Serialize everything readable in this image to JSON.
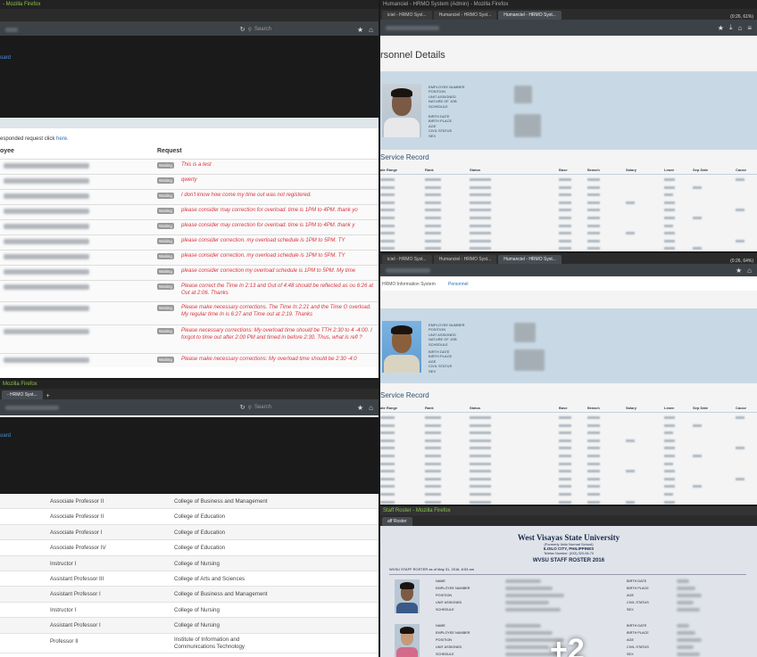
{
  "tile1": {
    "window_title": "- Mozilla Firefox",
    "search_placeholder": "Search",
    "sidebar_link": "oard",
    "note_prefix": "esponded request click",
    "note_link": "here.",
    "col_employee": "oyee",
    "col_request": "Request",
    "badge": "Waiting",
    "requests": [
      "This is a test",
      "qwerty",
      "I don't know how come my time out was not registered.",
      "please consider may correction for overload. time is 1PM to 4PM. thank yo",
      "please consider may correction for overload. time is 1PM to 4PM. thank y",
      "please consider correction. my overload schedule is 1PM to 5PM. TY",
      "please consider correction. my overload schedule is 1PM to 5PM. TY",
      "please consider correction my overload schedule is 1PM to 5PM. My time",
      "Please correct the Time In 2:13 and Out of 4:48 should be reflected as ou 6:26 at Out at 2:06. Thanks",
      "Please make necessary corrections. The Time In 2:21 and the Time O overload. My regular time In is 6:27 and Time out at 2:19. Thanks",
      "Please necessary corrections: My overload time should be TTH 2:30 to 4 -4:00. I forgot to time out after 2:00 PM and timed in before 2:30. Thus, what is refl ?",
      "Please make necessary corrections: My overload time should be 2:30 -4:0"
    ]
  },
  "tile2": {
    "window_title": "Humanciel - HRMO System (Admin) - Mozilla Firefox",
    "tabs": [
      "iciel - HRMO Syst...",
      "Humanciel - HRMO Syst...",
      "Humanciel - HRMO Syst..."
    ],
    "battery": "(0:26, 61%)",
    "page_heading": "rsonnel Details",
    "section_heading": "Service Record",
    "labels_a": [
      "EMPLOYEE NUMBER",
      "POSITION",
      "UNIT ASSIGNED",
      "NATURE OF JOB",
      "SCHEDULE"
    ],
    "labels_b": [
      "BIRTH DATE",
      "BIRTH PLACE",
      "AGE",
      "CIVIL STATUS",
      "SEX"
    ],
    "columns": [
      "ate Range",
      "Rank",
      "Status",
      "Base",
      "Branch",
      "Salary",
      "Leave",
      "Sep Date",
      "Cause"
    ]
  },
  "tile3": {
    "tabs": [
      "iciel - HRMO Syst...",
      "Humanciel - HRMO Syst...",
      "Humanciel - HRMO Syst..."
    ],
    "battery": "(0:26, 64%)",
    "nav_title": "HRMO Information System",
    "nav_user": "Personnel",
    "section_heading": "Service Record",
    "labels_a": [
      "EMPLOYEE NUMBER",
      "POSITION",
      "UNIT ASSIGNED",
      "NATURE OF JOB",
      "SCHEDULE"
    ],
    "labels_b": [
      "BIRTH DATE",
      "BIRTH PLACE",
      "AGE",
      "CIVIL STATUS",
      "SEX"
    ],
    "columns": [
      "ate Range",
      "Rank",
      "Status",
      "Base",
      "Branch",
      "Salary",
      "Leave",
      "Sep Date",
      "Cause"
    ]
  },
  "tile4": {
    "window_title": "Mozilla Firefox",
    "tab": "- HRMO Syst...",
    "search_placeholder": "Search",
    "sidebar_link": "oard",
    "rows": [
      {
        "position": "Associate Professor II",
        "college": "College of Business and Management"
      },
      {
        "position": "Associate Professor II",
        "college": "College of Education"
      },
      {
        "position": "Associate Professor I",
        "college": "College of Education"
      },
      {
        "position": "Associate Professor IV",
        "college": "College of Education"
      },
      {
        "position": "Instructor I",
        "college": "College of Nursing"
      },
      {
        "position": "Assistant Professor III",
        "college": "College of Arts and Sciences"
      },
      {
        "position": "Assistant Professor I",
        "college": "College of Business and Management"
      },
      {
        "position": "Instructor I",
        "college": "College of Nursing"
      },
      {
        "position": "Assistant Professor I",
        "college": "College of Nursing"
      },
      {
        "position": "Professor II",
        "college": "Institute of Information and Communications Technology"
      }
    ]
  },
  "tile5": {
    "window_title": "Staff Roster - Mozilla Firefox",
    "tab": "aff Roster",
    "university": "West Visayas State University",
    "sub1": "(Formerly Iloilo Normal School)",
    "sub2": "ILOILO CITY, PHILIPPINES",
    "sub3": "Telefax Number: (033) 320-08-70",
    "roster_title": "WVSU STAFF ROSTER 2016",
    "roster_asof": "WVSU STAFF ROSTER as of May 31, 2016, 8:53 am",
    "labels_left": [
      "NAME",
      "EMPLOYEE NUMBER",
      "POSITION",
      "UNIT ASSIGNED",
      "SCHEDULE"
    ],
    "labels_right": [
      "BIRTH DATE",
      "BIRTH PLACE",
      "AGE",
      "CIVIL STATUS",
      "SEX"
    ],
    "more_count": "+2"
  }
}
